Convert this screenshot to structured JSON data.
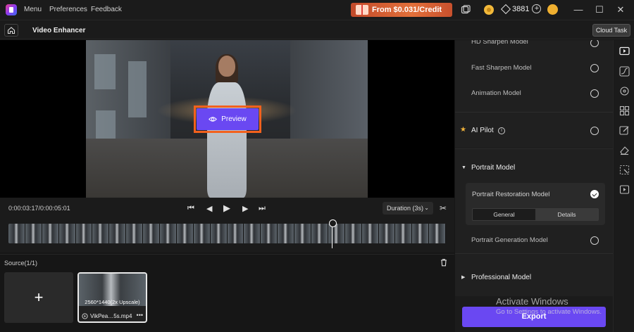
{
  "titlebar": {
    "menu": "Menu",
    "preferences": "Preferences",
    "feedback": "Feedback",
    "promo": "From $0.031/Credit",
    "credits": "3881"
  },
  "subbar": {
    "title": "Video Enhancer",
    "cloud_task": "Cloud Task"
  },
  "preview": {
    "button_label": "Preview"
  },
  "playback": {
    "timecode": "0:00:03:17/0:00:05:01",
    "duration": "Duration (3s)"
  },
  "source": {
    "label": "Source(1/1)",
    "add": "+",
    "clip": {
      "resolution": "2560*1440(2x Upscale)",
      "name": "VikPea…5s.mp4",
      "more": "•••"
    }
  },
  "panel": {
    "models_top": [
      {
        "label": "HD Sharpen Model",
        "selected": false
      },
      {
        "label": "Fast Sharpen Model",
        "selected": false
      },
      {
        "label": "Animation Model",
        "selected": false
      }
    ],
    "ai_pilot": "AI Pilot",
    "portrait_section": "Portrait Model",
    "portrait_restoration": "Portrait Restoration Model",
    "tabs": [
      "General",
      "Details"
    ],
    "active_tab": "Details",
    "portrait_generation": "Portrait Generation Model",
    "professional_section": "Professional Model",
    "export": "Export"
  },
  "watermark": {
    "line1": "Activate Windows",
    "line2": "Go to Settings to activate Windows."
  },
  "colors": {
    "accent": "#6a48f2",
    "highlight_outline": "#f2611d",
    "background": "#161616"
  },
  "icons": [
    "app-logo-icon",
    "screen-icon",
    "coin-icon",
    "diamond-icon",
    "plus-icon",
    "avatar-icon",
    "minimize-icon",
    "maximize-icon",
    "close-icon",
    "home-icon",
    "eye-icon",
    "skip-back-icon",
    "prev-frame-icon",
    "play-icon",
    "next-frame-icon",
    "skip-forward-icon",
    "scissors-icon",
    "trash-icon",
    "star-icon",
    "info-icon"
  ]
}
